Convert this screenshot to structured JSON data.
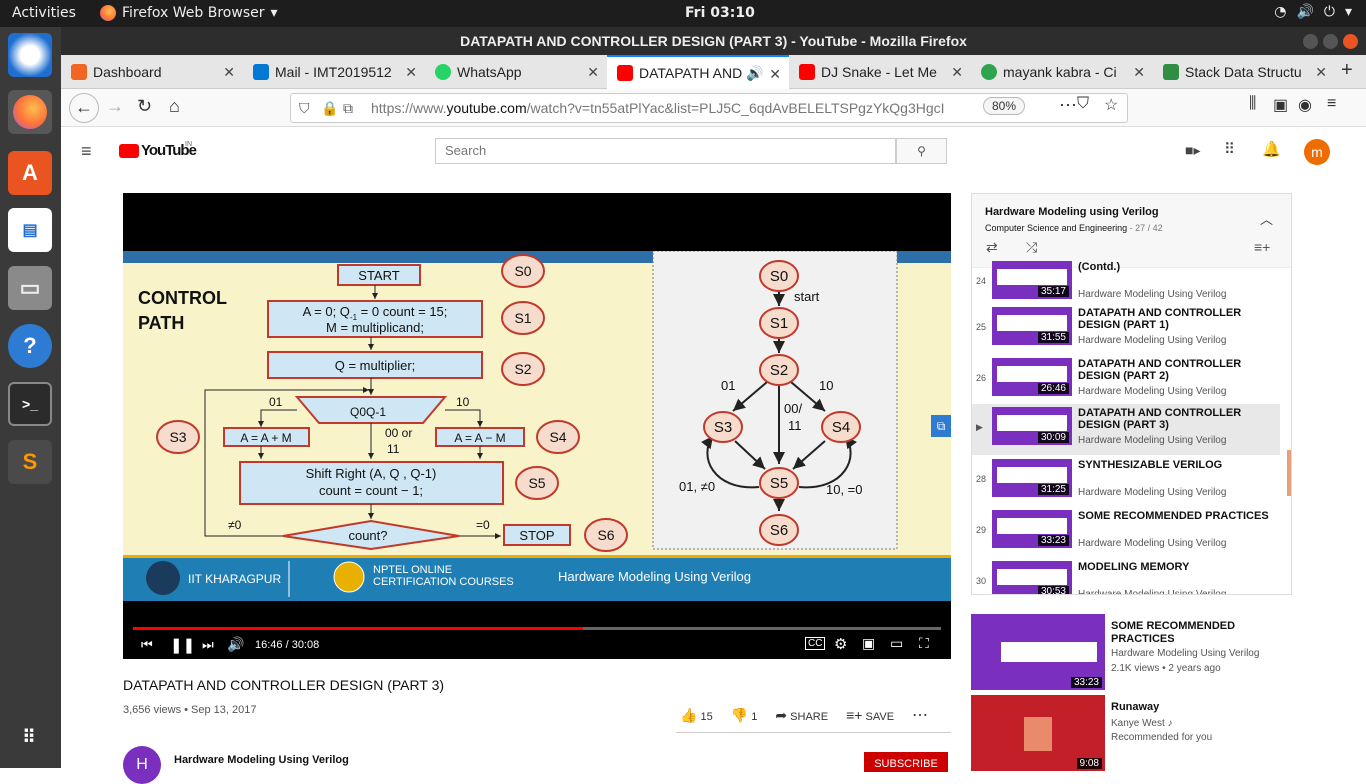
{
  "system": {
    "activities": "Activities",
    "app_name": "Firefox Web Browser",
    "clock": "Fri 03:10"
  },
  "window": {
    "title": "DATAPATH AND CONTROLLER DESIGN (PART 3) - YouTube - Mozilla Firefox"
  },
  "tabs": [
    {
      "label": "Dashboard",
      "color": "#f26522"
    },
    {
      "label": "Mail - IMT2019512",
      "color": "#0078d4"
    },
    {
      "label": "WhatsApp",
      "color": "#25d366"
    },
    {
      "label": "DATAPATH AND",
      "color": "#ff0000"
    },
    {
      "label": "DJ Snake - Let Me",
      "color": "#ff0000"
    },
    {
      "label": "mayank kabra - Ci",
      "color": "#2ea44f"
    },
    {
      "label": "Stack Data Structu",
      "color": "#2f8d46"
    }
  ],
  "url": {
    "prefix": "https://www.",
    "domain": "youtube.com",
    "rest": "/watch?v=tn55atPlYac&list=PLJ5C_6qdAvBELELTSPgzYkQg3HgcI",
    "zoom": "80%"
  },
  "youtube": {
    "logo": "YouTube",
    "region": "IN",
    "search_placeholder": "Search",
    "avatar_letter": "m"
  },
  "slide": {
    "left_title_1": "CONTROL",
    "left_title_2": "PATH",
    "start": "START",
    "b1a": "A = 0;  Q",
    "b1b": "-1",
    "b1c": " = 0 count = 15;",
    "b1d": "M = multiplicand;",
    "b2": "Q = multiplier;",
    "dec": "Q0Q-1",
    "b3": "A = A + M",
    "b4": "A = A − M",
    "b5a": "Shift Right (A, Q , Q-1)",
    "b5b": "count = count − 1;",
    "count": "count?",
    "stop": "STOP",
    "neq0": "≠0",
    "eq0": "=0",
    "l01": "01",
    "l10": "10",
    "l0011a": "00 or",
    "l0011b": "11",
    "s0": "S0",
    "s1": "S1",
    "s2": "S2",
    "s3": "S3",
    "s4": "S4",
    "s5": "S5",
    "s6": "S6",
    "r_start": "start",
    "r01": "01",
    "r10": "10",
    "r0011a": "00/",
    "r0011b": "11",
    "r01ne0": "01, ≠0",
    "r10e0": "10, =0",
    "footer_iit": "IIT KHARAGPUR",
    "footer_nptel1": "NPTEL ONLINE",
    "footer_nptel2": "CERTIFICATION COURSES",
    "footer_course": "Hardware Modeling Using Verilog"
  },
  "player": {
    "time": "16:46 / 30:08",
    "progress": 0.557
  },
  "video": {
    "title": "DATAPATH AND CONTROLLER DESIGN (PART 3)",
    "meta": "3,656 views • Sep 13, 2017",
    "likes": "15",
    "dislikes": "1",
    "share": "SHARE",
    "save": "SAVE"
  },
  "channel": {
    "name": "Hardware Modeling Using Verilog",
    "initial": "H",
    "subscribe": "SUBSCRIBE"
  },
  "playlist": {
    "title": "Hardware Modeling using Verilog",
    "subtitle": "Computer Science and Engineering",
    "position": "- 27 / 42",
    "items": [
      {
        "index": "24",
        "title": "(Contd.)",
        "channel": "Hardware Modeling Using Verilog",
        "duration": "35:17"
      },
      {
        "index": "25",
        "title": "DATAPATH AND CONTROLLER DESIGN (PART 1)",
        "channel": "Hardware Modeling Using Verilog",
        "duration": "31:55"
      },
      {
        "index": "26",
        "title": "DATAPATH AND CONTROLLER DESIGN (PART 2)",
        "channel": "Hardware Modeling Using Verilog",
        "duration": "26:46"
      },
      {
        "index": "▶",
        "title": "DATAPATH AND CONTROLLER DESIGN (PART 3)",
        "channel": "Hardware Modeling Using Verilog",
        "duration": "30:09"
      },
      {
        "index": "28",
        "title": "SYNTHESIZABLE VERILOG",
        "channel": "Hardware Modeling Using Verilog",
        "duration": "31:25"
      },
      {
        "index": "29",
        "title": "SOME RECOMMENDED PRACTICES",
        "channel": "Hardware Modeling Using Verilog",
        "duration": "33:23"
      },
      {
        "index": "30",
        "title": "MODELING MEMORY",
        "channel": "Hardware Modeling Using Verilog",
        "duration": "30:53"
      }
    ]
  },
  "recommended": [
    {
      "title": "SOME RECOMMENDED PRACTICES",
      "line1": "Hardware Modeling Using Verilog",
      "line2": "2.1K views • 2 years ago",
      "duration": "33:23"
    },
    {
      "title": "Runaway",
      "line1": "Kanye West ♪",
      "line2": "Recommended for you",
      "duration": "9:08"
    }
  ]
}
